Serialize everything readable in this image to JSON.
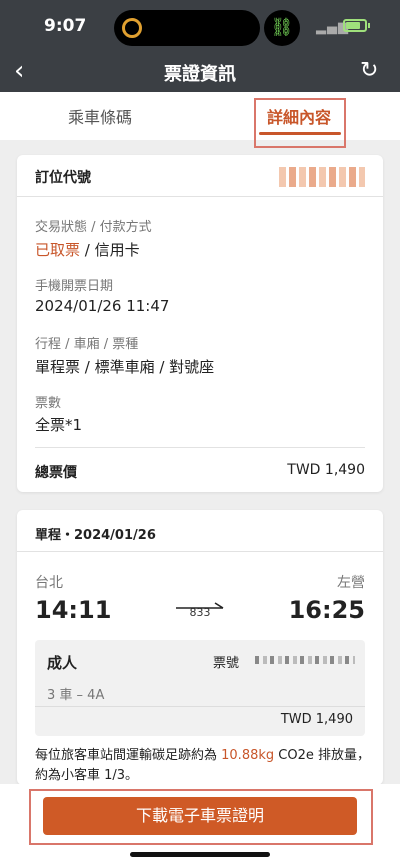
{
  "status": {
    "time": "9:07"
  },
  "nav": {
    "title": "票證資訊"
  },
  "tabs": [
    {
      "label": "乘車條碼"
    },
    {
      "label": "詳細內容"
    }
  ],
  "booking": {
    "code_label": "訂位代號",
    "status_label": "交易狀態 / 付款方式",
    "status_value": "已取票",
    "payment_value": " / 信用卡",
    "issue_label": "手機開票日期",
    "issue_value": "2024/01/26 11:47",
    "trip_label": "行程 / 車廂 / 票種",
    "trip_value": "單程票 / 標準車廂 / 對號座",
    "count_label": "票數",
    "count_value": "全票*1",
    "total_label": "總票價",
    "total_value": "TWD 1,490"
  },
  "journey": {
    "header": "單程・2024/01/26",
    "from_station": "台北",
    "to_station": "左營",
    "depart_time": "14:11",
    "arrive_time": "16:25",
    "train_no": "833",
    "passenger_type": "成人",
    "ticket_no_label": "票號",
    "seat": "3 車 – 4A",
    "price": "TWD 1,490",
    "carbon_prefix": "每位旅客車站間運輸碳足跡約為 ",
    "carbon_value": "10.88kg",
    "carbon_suffix": " CO2e 排放量，約為小客車 1/3。"
  },
  "actions": {
    "download_label": "下載電子車票證明"
  },
  "colors": {
    "accent": "#c8562a",
    "header_bg": "#3b3f44",
    "highlight": "#d9766a"
  }
}
